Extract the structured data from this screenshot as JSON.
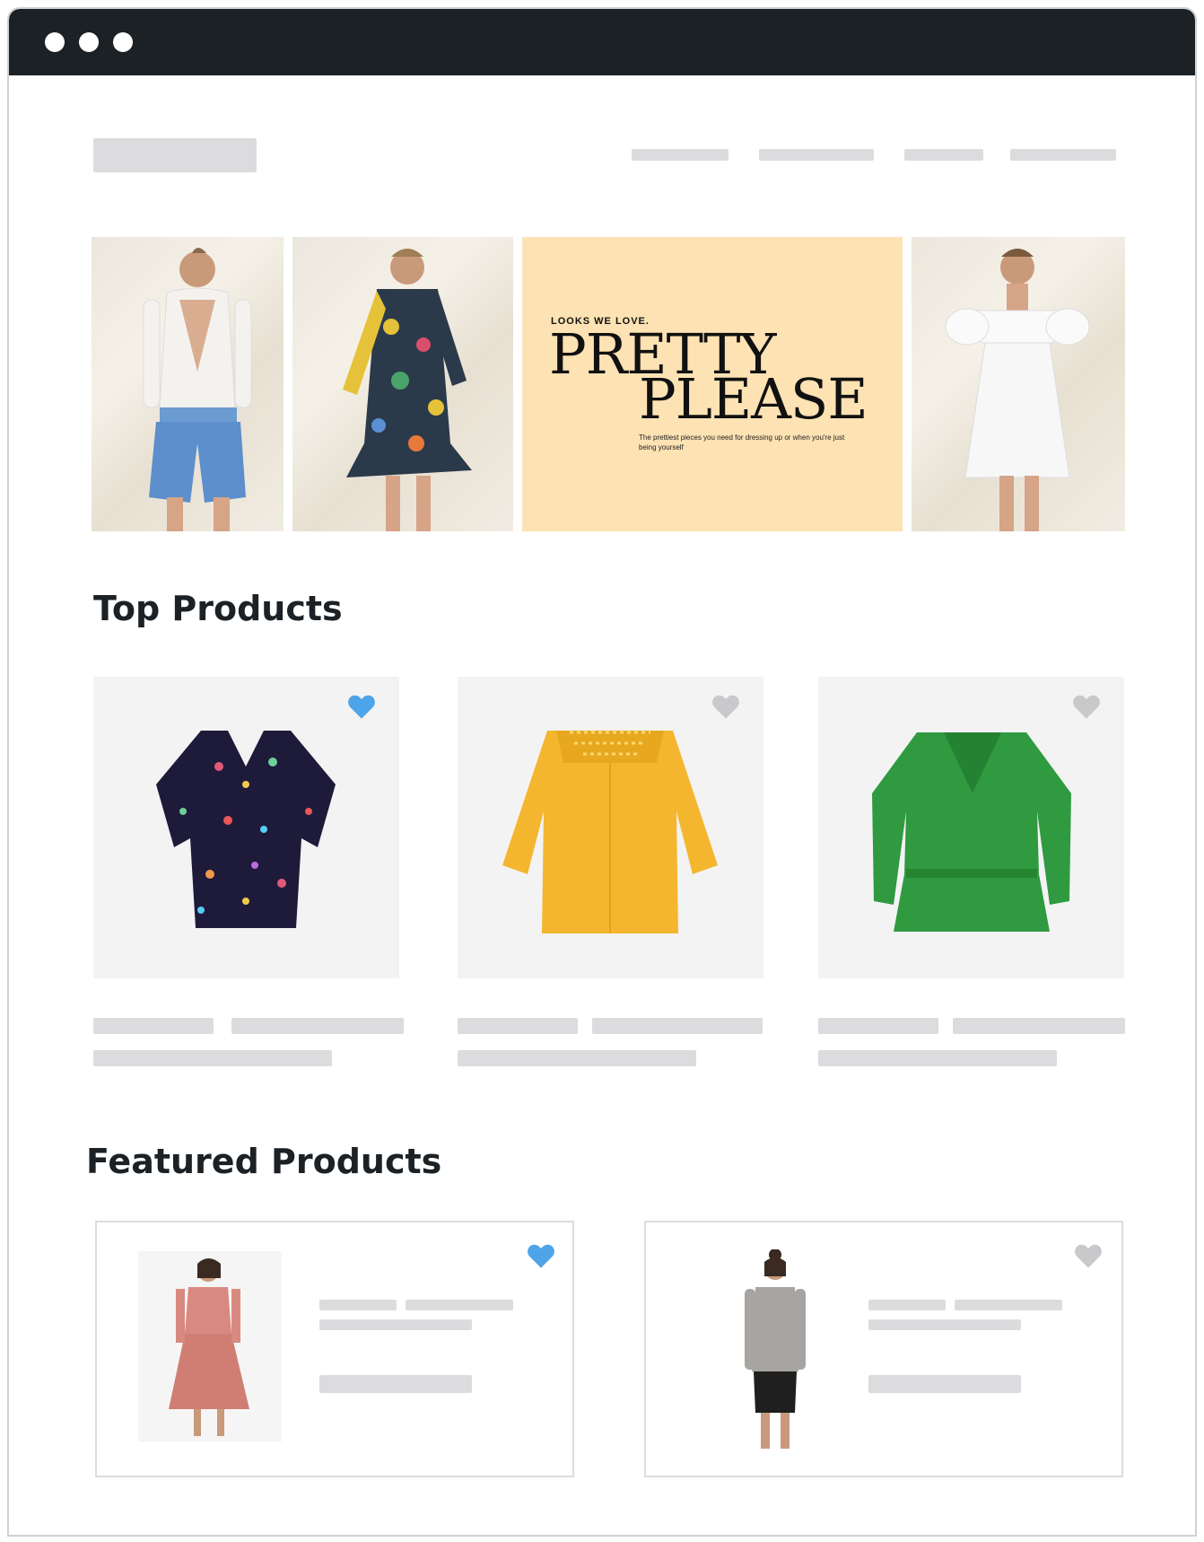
{
  "window": {
    "controls": [
      "dot",
      "dot",
      "dot"
    ]
  },
  "banner": {
    "promo": {
      "kicker": "LOOKS WE LOVE.",
      "title_line1": "PRETTY",
      "title_line2": "PLEASE",
      "subtitle": "The prettiest pieces you need for dressing up or when you're just being yourself"
    }
  },
  "sections": {
    "top_products": {
      "title": "Top Products",
      "items": [
        {
          "favorite": true,
          "product": "floral-blouse"
        },
        {
          "favorite": false,
          "product": "yellow-blouse"
        },
        {
          "favorite": false,
          "product": "green-blouse"
        }
      ]
    },
    "featured_products": {
      "title": "Featured Products",
      "items": [
        {
          "favorite": true,
          "product": "pink-dress"
        },
        {
          "favorite": false,
          "product": "grey-sweater"
        }
      ]
    }
  },
  "colors": {
    "titlebar": "#1b2125",
    "heart_active": "#4ea4e8",
    "heart_inactive": "#c9c9cc",
    "placeholder": "#dcdcde",
    "promo_bg": "#fde2b3"
  }
}
